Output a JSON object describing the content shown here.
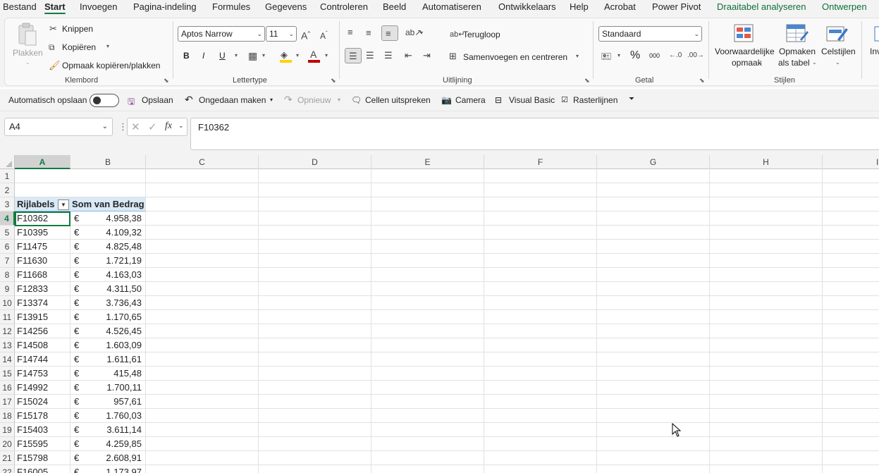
{
  "menu": {
    "tabs": [
      "Bestand",
      "Start",
      "Invoegen",
      "Pagina-indeling",
      "Formules",
      "Gegevens",
      "Controleren",
      "Beeld",
      "Automatiseren",
      "Ontwikkelaars",
      "Help",
      "Acrobat",
      "Power Pivot"
    ],
    "active": "Start",
    "context_tabs": [
      "Draaitabel analyseren",
      "Ontwerpen"
    ]
  },
  "ribbon": {
    "clipboard": {
      "paste": "Plakken",
      "cut": "Knippen",
      "copy": "Kopiëren",
      "format_painter": "Opmaak kopiëren/plakken",
      "label": "Klembord"
    },
    "font": {
      "name": "Aptos Narrow",
      "size": "11",
      "bold": "B",
      "italic": "I",
      "underline": "U",
      "label": "Lettertype",
      "fill_color": "#ffd400",
      "font_color": "#c00000"
    },
    "alignment": {
      "wrap": "Terugloop",
      "merge": "Samenvoegen en centreren",
      "label": "Uitlijning"
    },
    "number": {
      "format": "Standaard",
      "percent": "%",
      "thousands": "000",
      "label": "Getal"
    },
    "styles": {
      "conditional": [
        "Voorwaardelijke",
        "opmaak"
      ],
      "as_table": [
        "Opmaken",
        "als tabel"
      ],
      "cell_styles": "Celstijlen",
      "label": "Stijlen",
      "insert_partial": "Inv"
    }
  },
  "qat": {
    "autosave": "Automatisch opslaan",
    "save": "Opslaan",
    "undo": "Ongedaan maken",
    "redo": "Opnieuw",
    "speak": "Cellen uitspreken",
    "camera": "Camera",
    "vb": "Visual Basic",
    "gridlines": "Rasterlijnen"
  },
  "formula": {
    "namebox": "A4",
    "fx": "fx",
    "value": "F10362"
  },
  "sheet": {
    "columns": [
      "A",
      "B",
      "C",
      "D",
      "E",
      "F",
      "G",
      "H",
      "I"
    ],
    "selected_column": "A",
    "selected_row": "4",
    "header": {
      "row": "3",
      "label": "Rijlabels",
      "value": "Som van Bedrag"
    },
    "empty_rows": [
      "1",
      "2"
    ],
    "currency": "€",
    "rows": [
      {
        "row": "4",
        "label": "F10362",
        "amount": "4.958,38"
      },
      {
        "row": "5",
        "label": "F10395",
        "amount": "4.109,32"
      },
      {
        "row": "6",
        "label": "F11475",
        "amount": "4.825,48"
      },
      {
        "row": "7",
        "label": "F11630",
        "amount": "1.721,19"
      },
      {
        "row": "8",
        "label": "F11668",
        "amount": "4.163,03"
      },
      {
        "row": "9",
        "label": "F12833",
        "amount": "4.311,50"
      },
      {
        "row": "10",
        "label": "F13374",
        "amount": "3.736,43"
      },
      {
        "row": "11",
        "label": "F13915",
        "amount": "1.170,65"
      },
      {
        "row": "12",
        "label": "F14256",
        "amount": "4.526,45"
      },
      {
        "row": "13",
        "label": "F14508",
        "amount": "1.603,09"
      },
      {
        "row": "14",
        "label": "F14744",
        "amount": "1.611,61"
      },
      {
        "row": "15",
        "label": "F14753",
        "amount": "415,48"
      },
      {
        "row": "16",
        "label": "F14992",
        "amount": "1.700,11"
      },
      {
        "row": "17",
        "label": "F15024",
        "amount": "957,61"
      },
      {
        "row": "18",
        "label": "F15178",
        "amount": "1.760,03"
      },
      {
        "row": "19",
        "label": "F15403",
        "amount": "3.611,14"
      },
      {
        "row": "20",
        "label": "F15595",
        "amount": "4.259,85"
      },
      {
        "row": "21",
        "label": "F15798",
        "amount": "2.608,91"
      },
      {
        "row": "22",
        "label": "F16005",
        "amount": "1.173,97"
      }
    ]
  }
}
